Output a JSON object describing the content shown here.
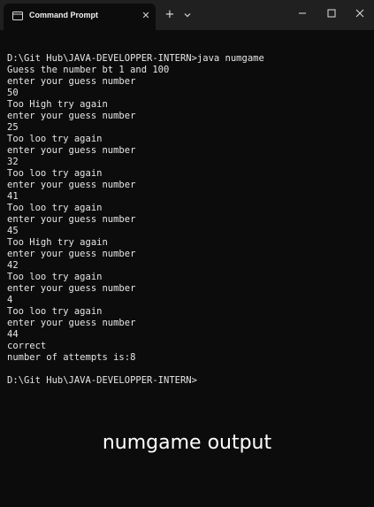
{
  "window": {
    "tab_title": "Command Prompt",
    "icons": {
      "tab": "terminal-icon",
      "tab_close": "close-icon",
      "new_tab": "plus-icon",
      "dropdown": "chevron-down-icon",
      "minimize": "minimize-icon",
      "maximize": "maximize-icon",
      "close": "close-icon"
    }
  },
  "console": {
    "lines": [
      "",
      "D:\\Git Hub\\JAVA-DEVELOPPER-INTERN>java numgame",
      "Guess the number bt 1 and 100",
      "enter your guess number",
      "50",
      "Too High try again",
      "enter your guess number",
      "25",
      "Too loo try again",
      "enter your guess number",
      "32",
      "Too loo try again",
      "enter your guess number",
      "41",
      "Too loo try again",
      "enter your guess number",
      "45",
      "Too High try again",
      "enter your guess number",
      "42",
      "Too loo try again",
      "enter your guess number",
      "4",
      "Too loo try again",
      "enter your guess number",
      "44",
      "correct",
      "number of attempts is:8",
      "",
      "D:\\Git Hub\\JAVA-DEVELOPPER-INTERN>"
    ]
  },
  "caption": "numgame output",
  "colors": {
    "background": "#0c0c0c",
    "titlebar": "#202020",
    "text": "#e6e6e6"
  }
}
